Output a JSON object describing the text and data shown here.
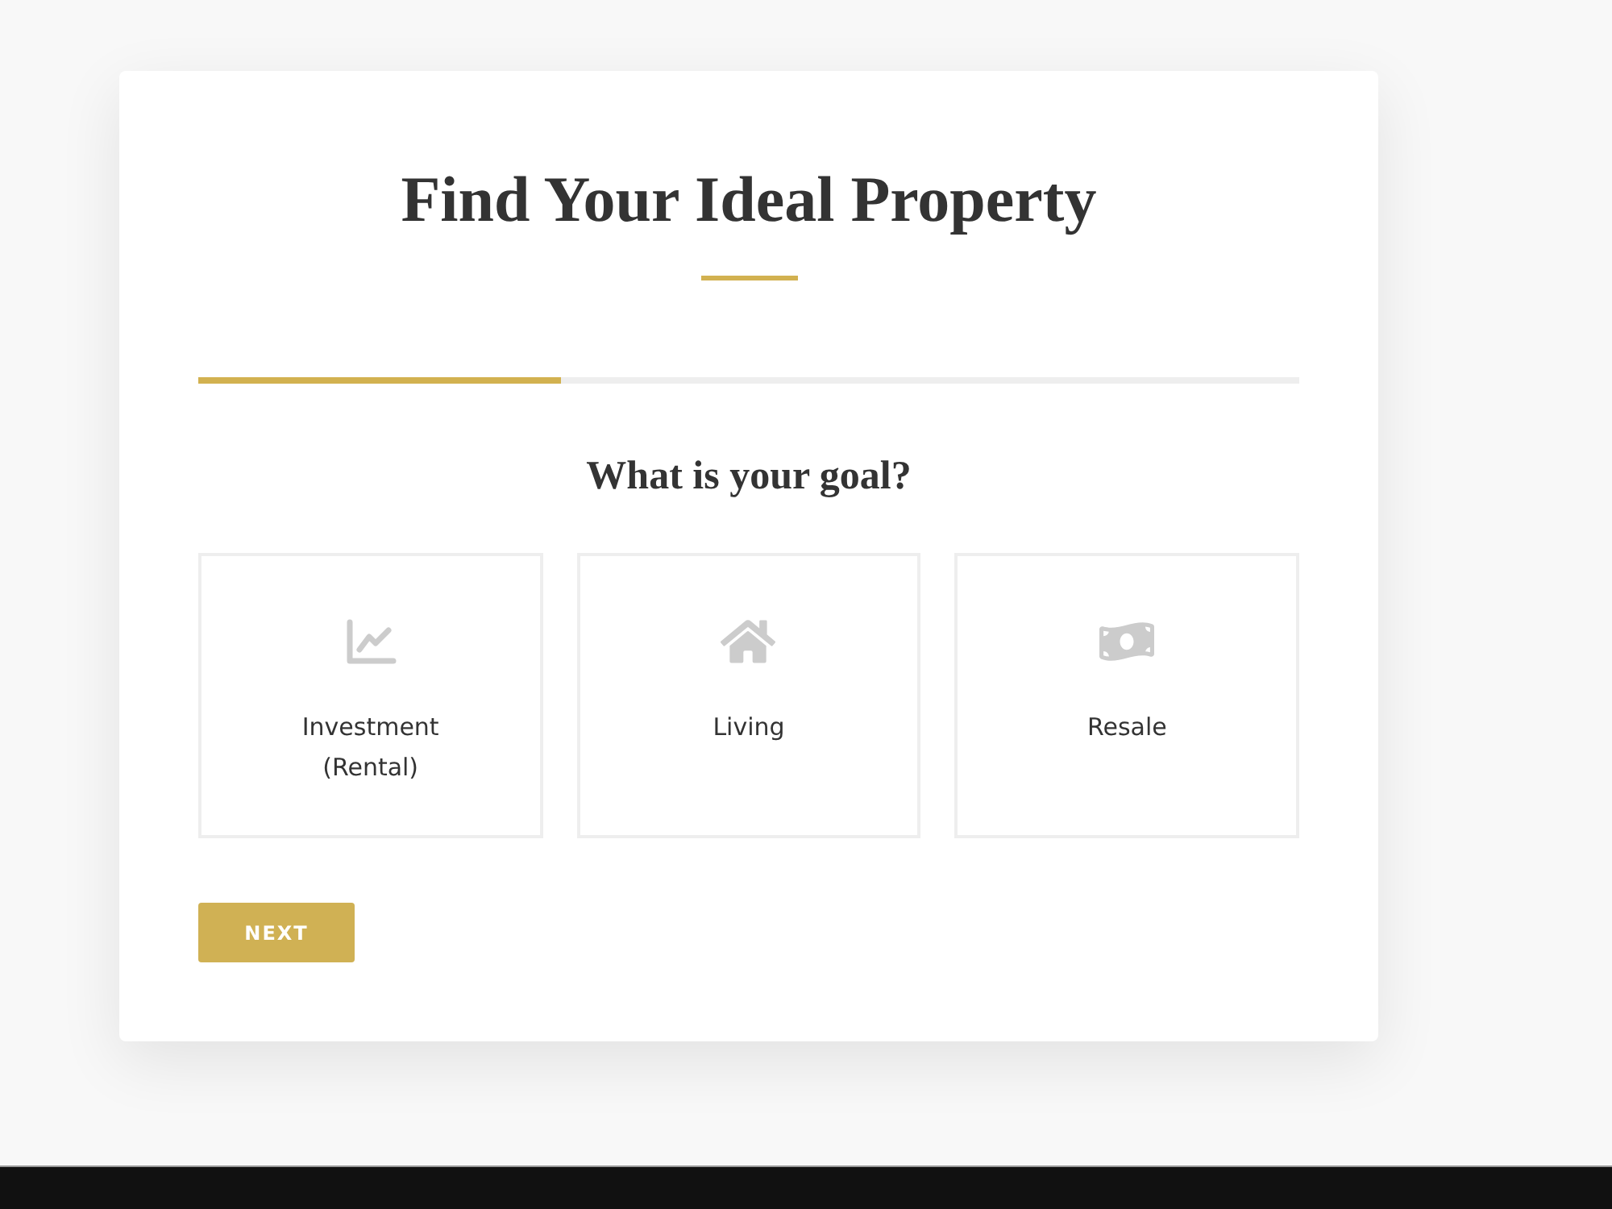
{
  "form": {
    "title": "Find Your Ideal Property",
    "progress": {
      "level": 0.33
    },
    "question": "What is your goal?",
    "options": [
      {
        "label": "Investment (Rental)",
        "selected": false
      },
      {
        "label": "Living",
        "selected": false
      },
      {
        "label": "Resale",
        "selected": false
      }
    ],
    "next_button": "NEXT"
  }
}
